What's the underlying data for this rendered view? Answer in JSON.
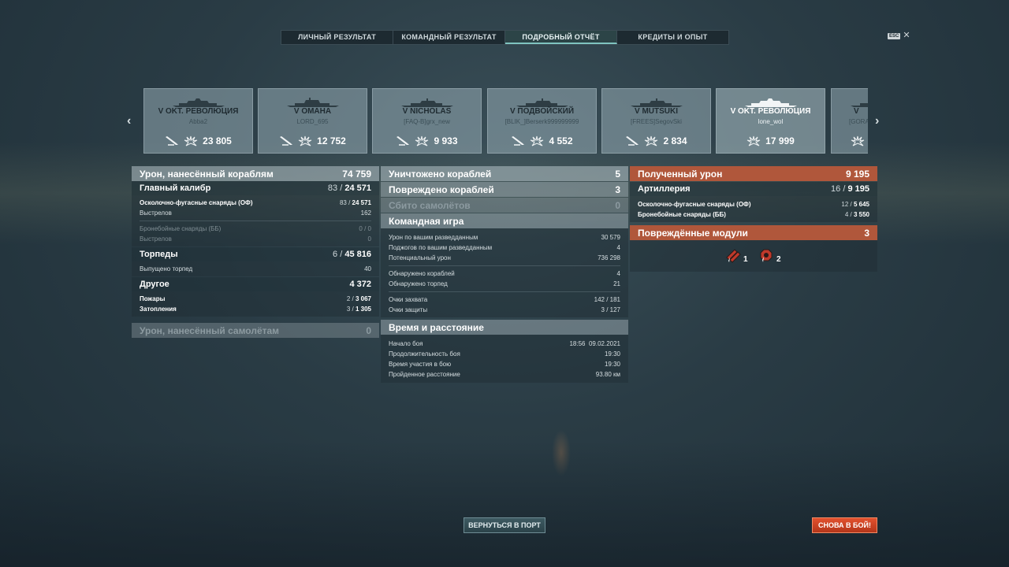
{
  "tabs": [
    {
      "label": "ЛИЧНЫЙ РЕЗУЛЬТАТ"
    },
    {
      "label": "КОМАНДНЫЙ РЕЗУЛЬТАТ"
    },
    {
      "label": "ПОДРОБНЫЙ ОТЧЁТ"
    },
    {
      "label": "КРЕДИТЫ И ОПЫТ"
    }
  ],
  "active_tab": "ПОДРОБНЫЙ ОТЧЁТ",
  "esc": {
    "key": "ESC",
    "close": "✕"
  },
  "carousel": {
    "prev": "‹",
    "next": "›",
    "cards": [
      {
        "ship": "V OKT. РЕВОЛЮЦИЯ",
        "player": "Abba2",
        "damage": "23 805"
      },
      {
        "ship": "V OMAHA",
        "player": "LORD_695",
        "damage": "12 752"
      },
      {
        "ship": "V NICHOLAS",
        "player": "[FAQ-B]grx_new",
        "damage": "9 933"
      },
      {
        "ship": "V ПОДВОЙСКИЙ",
        "player": "[BLIK_]Berserk999999999",
        "damage": "4 552"
      },
      {
        "ship": "V MUTSUKI",
        "player": "[FREES]SegovSki",
        "damage": "2 834"
      },
      {
        "ship": "V OKT. РЕВОЛЮЦИЯ",
        "player": "lone_wol",
        "damage": "17 999"
      },
      {
        "ship": "V",
        "player": "[GORA",
        "damage": ""
      }
    ]
  },
  "left": {
    "ship_damage": {
      "label": "Урон, нанесённый кораблям",
      "value": "74 759"
    },
    "main_caliber": {
      "label": "Главный калибр",
      "a": "83",
      "b": "24 571"
    },
    "he": {
      "label": "Осколочно-фугасные снаряды (ОФ)",
      "a": "83",
      "b": "24 571"
    },
    "he_shots": {
      "label": "Выстрелов",
      "value": "162"
    },
    "ap": {
      "label": "Бронебойные снаряды (ББ)",
      "a": "0",
      "b": "0"
    },
    "ap_shots": {
      "label": "Выстрелов",
      "value": "0"
    },
    "torpedoes": {
      "label": "Торпеды",
      "a": "6",
      "b": "45 816"
    },
    "torp_fired": {
      "label": "Выпущено торпед",
      "value": "40"
    },
    "other": {
      "label": "Другое",
      "value": "4 372"
    },
    "fires": {
      "label": "Пожары",
      "a": "2",
      "b": "3 067"
    },
    "floods": {
      "label": "Затопления",
      "a": "3",
      "b": "1 305"
    },
    "plane_damage": {
      "label": "Урон, нанесённый самолётам",
      "value": "0"
    }
  },
  "mid": {
    "destroyed": {
      "label": "Уничтожено кораблей",
      "value": "5"
    },
    "damaged": {
      "label": "Повреждено кораблей",
      "value": "3"
    },
    "planes": {
      "label": "Сбито самолётов",
      "value": "0"
    },
    "team_title": "Командная игра",
    "spot_damage": {
      "label": "Урон по вашим разведданным",
      "value": "30 579"
    },
    "spot_fires": {
      "label": "Поджогов по вашим разведданным",
      "value": "4"
    },
    "potential": {
      "label": "Потенциальный урон",
      "value": "736 298"
    },
    "spotted_ships": {
      "label": "Обнаружено кораблей",
      "value": "4"
    },
    "spotted_torps": {
      "label": "Обнаружено торпед",
      "value": "21"
    },
    "capture": {
      "label": "Очки захвата",
      "value": "142 / 181"
    },
    "defense": {
      "label": "Очки защиты",
      "value": "3 / 127"
    },
    "time_title": "Время и расстояние",
    "start": {
      "label": "Начало боя",
      "value": "18:56  09.02.2021"
    },
    "duration": {
      "label": "Продолжительность боя",
      "value": "19:30"
    },
    "participation": {
      "label": "Время участия в бою",
      "value": "19:30"
    },
    "distance": {
      "label": "Пройденное расстояние",
      "value": "93.80 км"
    }
  },
  "right": {
    "received": {
      "label": "Полученный урон",
      "value": "9 195"
    },
    "artillery": {
      "label": "Артиллерия",
      "a": "16",
      "b": "9 195"
    },
    "he": {
      "label": "Осколочно-фугасные снаряды (ОФ)",
      "a": "12",
      "b": "5 645"
    },
    "ap": {
      "label": "Бронебойные снаряды (ББ)",
      "a": "4",
      "b": "3 550"
    },
    "modules": {
      "label": "Повреждённые модули",
      "value": "3"
    },
    "module_counts": [
      "1",
      "2"
    ]
  },
  "buttons": {
    "port": "ВЕРНУТЬСЯ В ПОРТ",
    "battle": "СНОВА В БОЙ!"
  },
  "colors": {
    "accent_orange": "#b0573b",
    "battle_button": "#d8482a",
    "active_tab_line": "#7fc4c0"
  }
}
